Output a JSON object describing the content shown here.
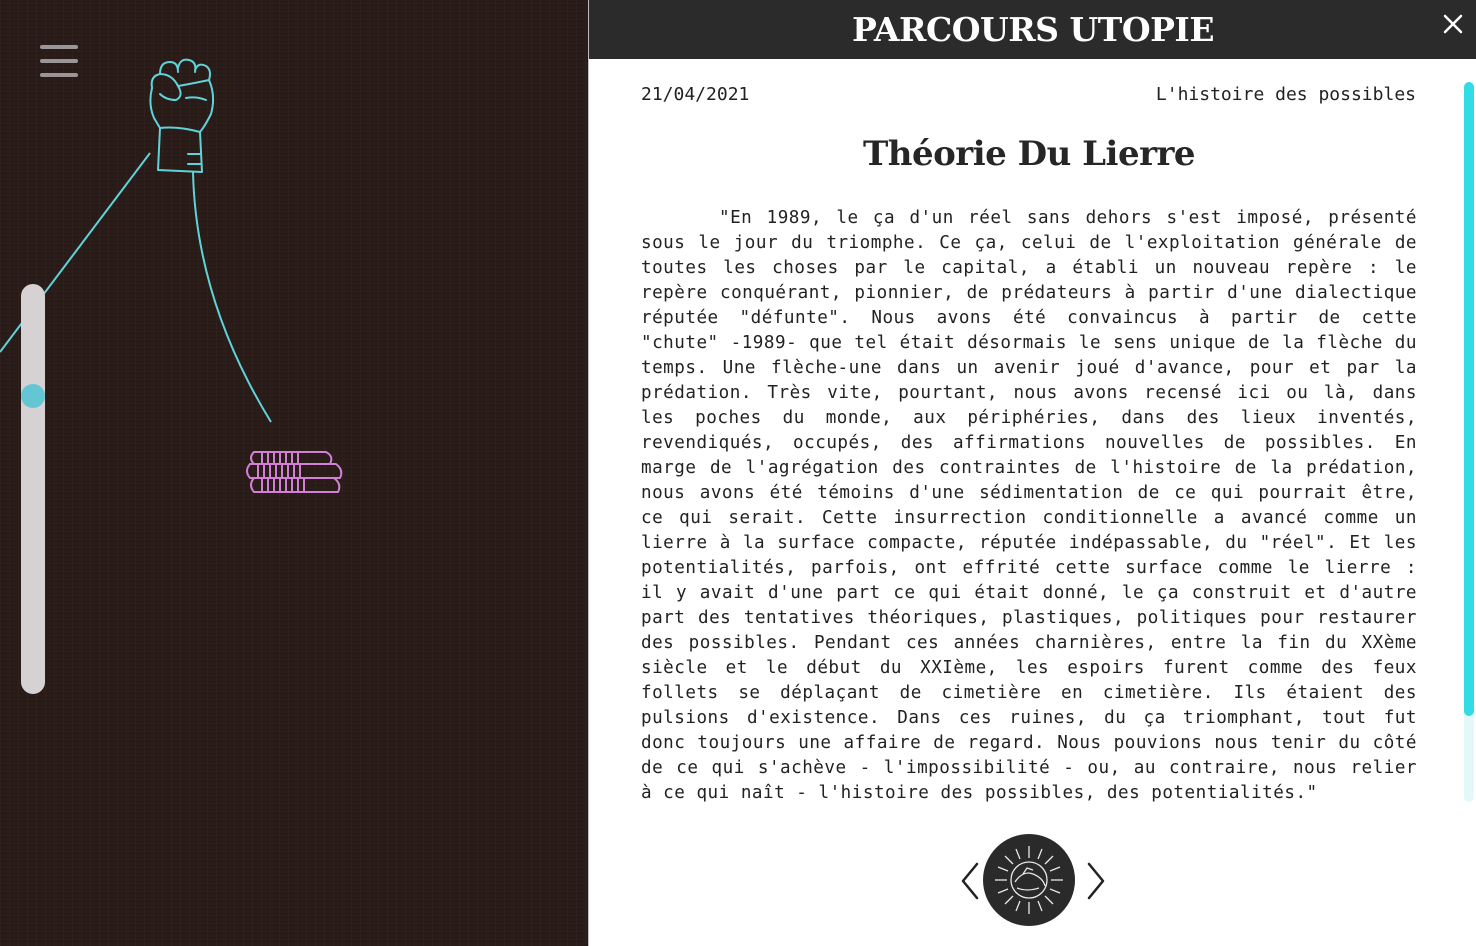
{
  "header": {
    "title": "PARCOURS UTOPIE",
    "close_icon": "close-icon"
  },
  "sidebar": {
    "menu_icon": "hamburger-menu-icon",
    "zoom_slider_level": 0.26
  },
  "map": {
    "icons": [
      "raised-fist-icon",
      "stacked-books-icon"
    ],
    "colors": {
      "background": "#2a1c18",
      "fist": "#5fd3da",
      "books": "#d37fd8",
      "path_line": "#5fd3da",
      "slider_track": "#d6d2d3",
      "slider_thumb": "#64c6d2"
    }
  },
  "article": {
    "date": "21/04/2021",
    "category": "L'histoire des possibles",
    "title": "Théorie Du Lierre",
    "body": "\"En 1989, le ça d'un réel sans dehors s'est imposé, présenté sous le jour du triomphe. Ce ça, celui de l'exploitation générale de toutes les choses par le capital, a établi un nouveau repère : le repère conquérant, pionnier, de prédateurs à partir d'une dialectique réputée \"défunte\". Nous avons été convaincus à partir de cette \"chute\" -1989- que tel était désormais le sens unique de la flèche du temps. Une flèche-une dans un avenir joué d'avance, pour et par la prédation. Très vite, pourtant, nous avons recensé ici ou là, dans les poches du monde, aux périphéries, dans des lieux inventés, revendiqués, occupés, des affirmations nouvelles de possibles. En marge de l'agrégation des contraintes de l'histoire de la prédation, nous avons été témoins d'une sédimentation de ce qui pourrait être, ce qui serait. Cette insurrection conditionnelle a avancé comme un lierre à la surface compacte, réputée indépassable, du \"réel\". Et les potentialités, parfois, ont effrité cette surface comme le lierre : il y avait d'une part ce qui était donné, le ça construit et d'autre part des tentatives théoriques, plastiques, politiques pour restaurer des possibles. Pendant ces années charnières, entre la fin du XXème siècle et le début du XXIème, les espoirs furent comme des feux follets se déplaçant de cimetière en cimetière. Ils étaient des pulsions d'existence. Dans ces ruines, du ça triomphant, tout fut donc toujours une affaire de regard. Nous pouvions nous tenir du côté de ce qui s'achève - l'impossibilité - ou, au contraire, nous relier à ce qui naît - l'histoire des possibles, des potentialités.\"",
    "scroll_progress": 0.88,
    "accent_color": "#33dbe6"
  },
  "navigation": {
    "prev_icon": "chevron-left-icon",
    "next_icon": "chevron-right-icon",
    "emblem_icon": "emblem-badge-icon"
  }
}
